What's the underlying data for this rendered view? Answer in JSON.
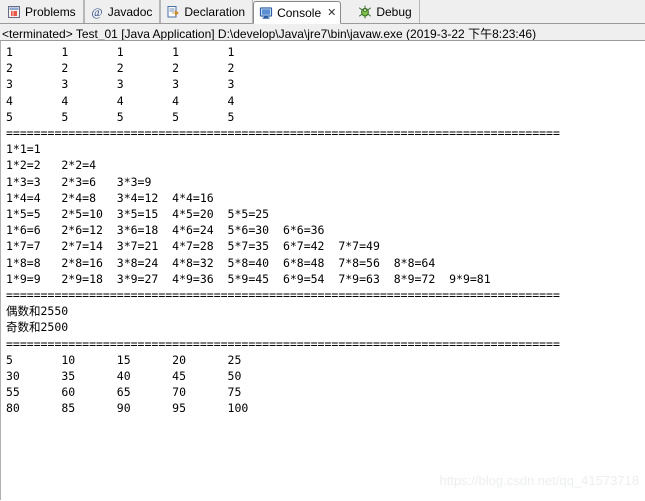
{
  "window": {
    "view_name": "Console"
  },
  "tabs": [
    {
      "label": "Problems",
      "icon": "problems-icon",
      "active": false,
      "closable": false
    },
    {
      "label": "Javadoc",
      "icon": "javadoc-icon",
      "active": false,
      "closable": false
    },
    {
      "label": "Declaration",
      "icon": "declaration-icon",
      "active": false,
      "closable": false
    },
    {
      "label": "Console",
      "icon": "console-icon",
      "active": true,
      "closable": true
    },
    {
      "label": "Debug",
      "icon": "debug-icon",
      "active": false,
      "closable": false
    }
  ],
  "tab_close_glyph": "✕",
  "launch": {
    "status": "<terminated>",
    "config_name": "Test_01",
    "type": "[Java Application]",
    "vm_path": "D:\\develop\\Java\\jre7\\bin\\javaw.exe",
    "timestamp": "(2019-3-22 下午8:23:46)",
    "full_line": "<terminated> Test_01 [Java Application] D:\\develop\\Java\\jre7\\bin\\javaw.exe (2019-3-22 下午8:23:46)"
  },
  "console": {
    "separator": "================================================================================",
    "section1_grid": {
      "rows": [
        [
          "1",
          "1",
          "1",
          "1",
          "1"
        ],
        [
          "2",
          "2",
          "2",
          "2",
          "2"
        ],
        [
          "3",
          "3",
          "3",
          "3",
          "3"
        ],
        [
          "4",
          "4",
          "4",
          "4",
          "4"
        ],
        [
          "5",
          "5",
          "5",
          "5",
          "5"
        ]
      ]
    },
    "section2_multiplication_table": {
      "rows": [
        [
          "1*1=1"
        ],
        [
          "1*2=2",
          "2*2=4"
        ],
        [
          "1*3=3",
          "2*3=6",
          "3*3=9"
        ],
        [
          "1*4=4",
          "2*4=8",
          "3*4=12",
          "4*4=16"
        ],
        [
          "1*5=5",
          "2*5=10",
          "3*5=15",
          "4*5=20",
          "5*5=25"
        ],
        [
          "1*6=6",
          "2*6=12",
          "3*6=18",
          "4*6=24",
          "5*6=30",
          "6*6=36"
        ],
        [
          "1*7=7",
          "2*7=14",
          "3*7=21",
          "4*7=28",
          "5*7=35",
          "6*7=42",
          "7*7=49"
        ],
        [
          "1*8=8",
          "2*8=16",
          "3*8=24",
          "4*8=32",
          "5*8=40",
          "6*8=48",
          "7*8=56",
          "8*8=64"
        ],
        [
          "1*9=9",
          "2*9=18",
          "3*9=27",
          "4*9=36",
          "5*9=45",
          "6*9=54",
          "7*9=63",
          "8*9=72",
          "9*9=81"
        ]
      ]
    },
    "section3_sums": {
      "even_sum_line": "偶数和2550",
      "odd_sum_line": "奇数和2500"
    },
    "section4_multiples_of_five": {
      "rows": [
        [
          "5",
          "10",
          "15",
          "20",
          "25"
        ],
        [
          "30",
          "35",
          "40",
          "45",
          "50"
        ],
        [
          "55",
          "60",
          "65",
          "70",
          "75"
        ],
        [
          "80",
          "85",
          "90",
          "95",
          "100"
        ]
      ]
    },
    "full_text": "1       1       1       1       1\n2       2       2       2       2\n3       3       3       3       3\n4       4       4       4       4\n5       5       5       5       5\n================================================================================\n1*1=1\n1*2=2   2*2=4\n1*3=3   2*3=6   3*3=9\n1*4=4   2*4=8   3*4=12  4*4=16\n1*5=5   2*5=10  3*5=15  4*5=20  5*5=25\n1*6=6   2*6=12  3*6=18  4*6=24  5*6=30  6*6=36\n1*7=7   2*7=14  3*7=21  4*7=28  5*7=35  6*7=42  7*7=49\n1*8=8   2*8=16  3*8=24  4*8=32  5*8=40  6*8=48  7*8=56  8*8=64\n1*9=9   2*9=18  3*9=27  4*9=36  5*9=45  6*9=54  7*9=63  8*9=72  9*9=81\n================================================================================\n偶数和2550\n奇数和2500\n================================================================================\n5       10      15      20      25\n30      35      40      45      50\n55      60      65      70      75\n80      85      90      95      100"
  },
  "watermark": {
    "text": "https://blog.csdn.net/qq_41573718"
  }
}
